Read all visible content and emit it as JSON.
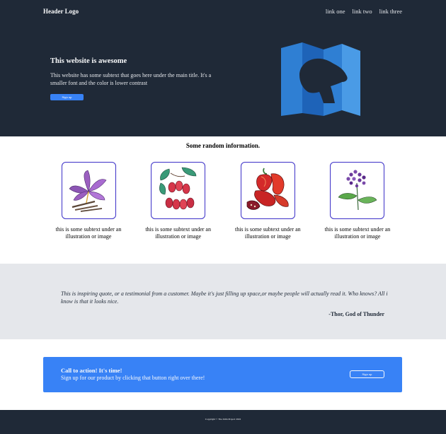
{
  "header": {
    "logo": "Header Logo",
    "nav": [
      "link one",
      "link two",
      "link three"
    ]
  },
  "hero": {
    "title": "This website is awesome",
    "subtitle": "This website has some subtext that goes here under the main title. It's a smaller font and the color is lower contrast",
    "button_label": "Sign up",
    "image_icon": "map-with-lion-icon"
  },
  "info": {
    "title": "Some random information.",
    "cards": [
      {
        "text": "this is some subtext under an illustration or image",
        "icon": "saffron-flower-icon"
      },
      {
        "text": "this is some subtext under an illustration or image",
        "icon": "berries-icon"
      },
      {
        "text": "this is some subtext under an illustration or image",
        "icon": "red-pepper-icon"
      },
      {
        "text": "this is some subtext under an illustration or image",
        "icon": "purple-flower-icon"
      }
    ]
  },
  "quote": {
    "text": "This is inspiring quote, or a testimonial from a customer. Maybe it's just filling up space,or maybe people will actually read it. Who knows? All i know is that it looks nice.",
    "author": "-Thor, God of Thunder"
  },
  "cta": {
    "title": "Call to action! It's time!",
    "subtitle": "Sign up for our product by clicking that button right over there!",
    "button_label": "Sign up"
  },
  "footer": {
    "text": "Copyright © The Odin Project 2022"
  },
  "colors": {
    "dark": "#1f2937",
    "accent": "#3882f6",
    "light_gray": "#e5e7eb",
    "card_border": "#3b30c8"
  }
}
